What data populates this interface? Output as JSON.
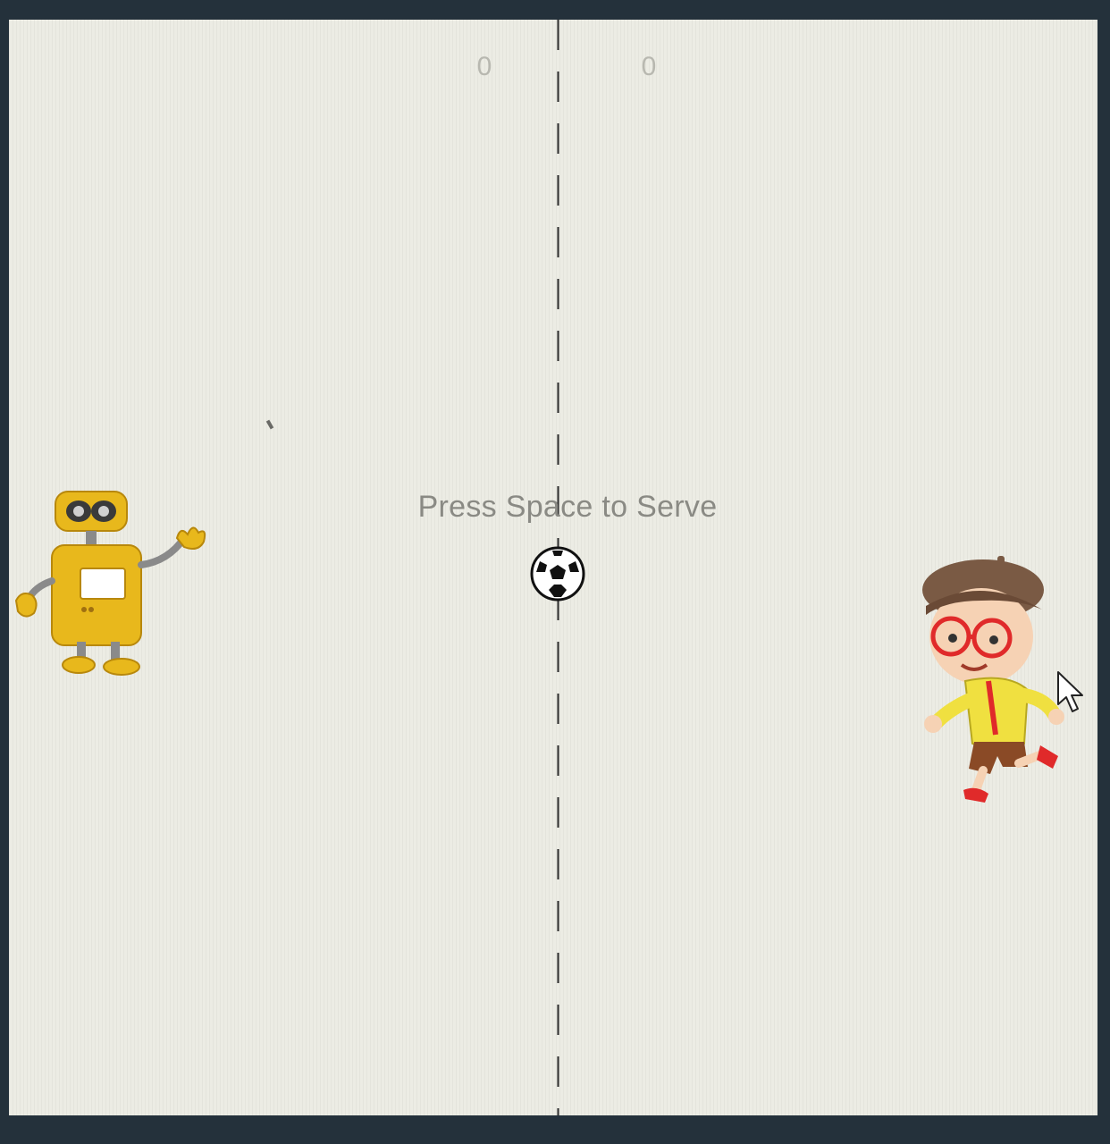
{
  "scoreboard": {
    "left_score": "0",
    "right_score": "0"
  },
  "message": {
    "serve_prompt": "Press Space to Serve"
  },
  "sprites": {
    "left_player": "robot-icon",
    "right_player": "boy-runner-icon",
    "ball": "soccer-ball-icon",
    "pointer": "mouse-cursor-icon"
  },
  "colors": {
    "court_background": "#ecece4",
    "center_line": "#2a2a2a",
    "score_text": "#b8b8b0",
    "message_text": "#8a8a84",
    "robot_yellow": "#e8b81c",
    "boy_shirt": "#f0e040"
  }
}
